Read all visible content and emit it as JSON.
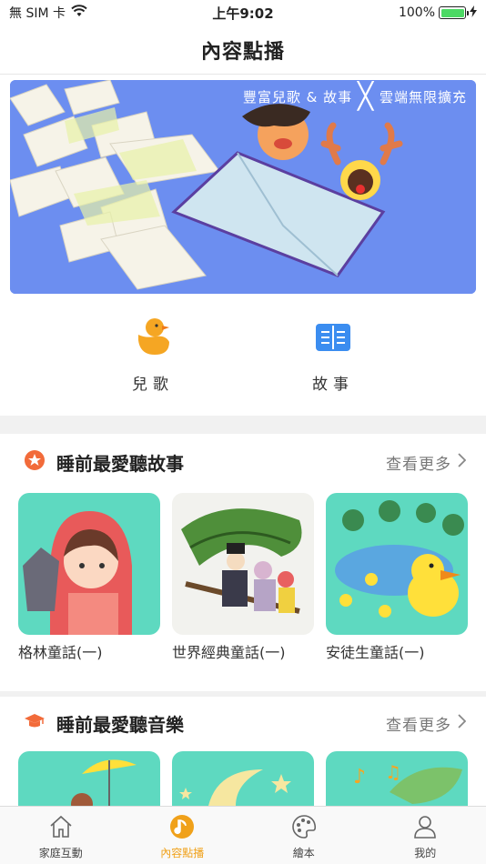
{
  "status_bar": {
    "carrier": "無 SIM 卡",
    "time": "上午9:02",
    "battery": "100%",
    "battery_level": 1.0
  },
  "nav": {
    "title": "內容點播"
  },
  "banner": {
    "caption_left": "豐富兒歌 & 故事",
    "caption_right": "雲端無限擴充"
  },
  "categories": [
    {
      "label": "兒歌",
      "icon": "duck-icon"
    },
    {
      "label": "故事",
      "icon": "book-icon"
    }
  ],
  "sections": [
    {
      "title": "睡前最愛聽故事",
      "icon": "star-badge-icon",
      "more": "查看更多",
      "items": [
        {
          "label": "格林童話(一)"
        },
        {
          "label": "世界經典童話(一)"
        },
        {
          "label": "安徒生童話(一)"
        }
      ]
    },
    {
      "title": "睡前最愛聽音樂",
      "icon": "graduation-cap-icon",
      "more": "查看更多",
      "items": []
    }
  ],
  "tabs": [
    {
      "label": "家庭互動",
      "icon": "home-icon",
      "active": false
    },
    {
      "label": "內容點播",
      "icon": "music-note-icon",
      "active": true
    },
    {
      "label": "繪本",
      "icon": "palette-icon",
      "active": false
    },
    {
      "label": "我的",
      "icon": "user-icon",
      "active": false
    }
  ],
  "colors": {
    "accent": "#f0a11a",
    "banner_bg": "#6c8ef0",
    "card_bg": "#5ed9c0"
  }
}
